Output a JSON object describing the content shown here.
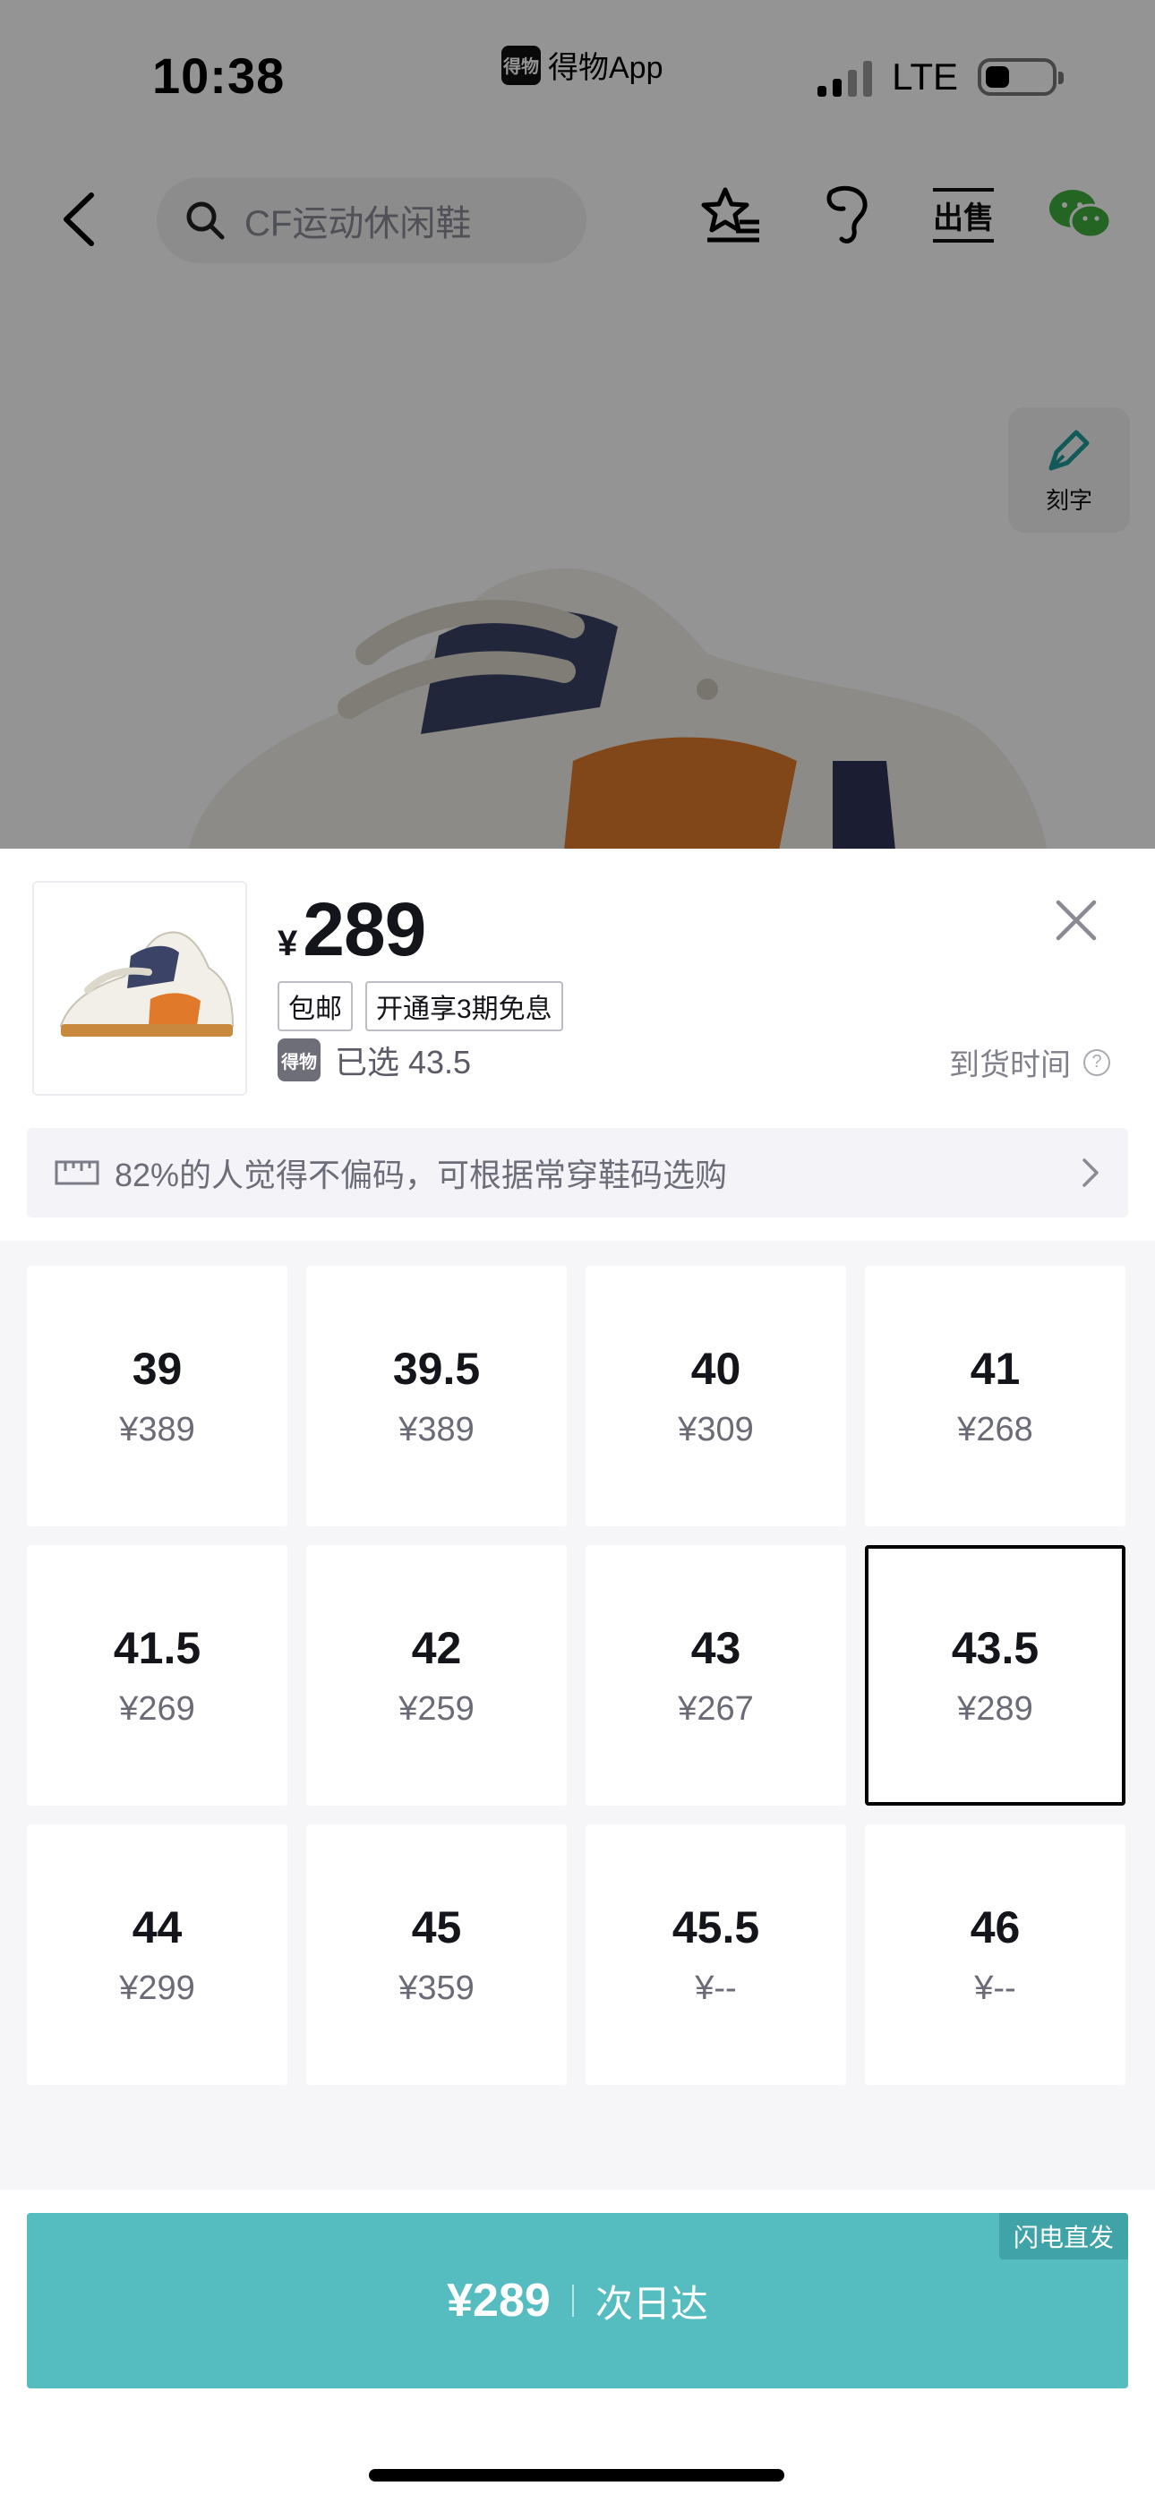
{
  "status_bar": {
    "time": "10:38",
    "app_badge": "得物",
    "app_name": "得物App",
    "network": "LTE"
  },
  "nav": {
    "search_placeholder": "CF运动休闲鞋",
    "sell_label": "出售",
    "engrave_label": "刻字"
  },
  "product": {
    "currency": "¥",
    "price": "289",
    "tags": [
      "包邮",
      "开通享3期免息"
    ],
    "brand_badge": "得物",
    "selected_text": "已选 43.5",
    "arrival_label": "到货时间",
    "help_icon": "?"
  },
  "fit_banner": {
    "text": "82%的人觉得不偏码，可根据常穿鞋码选购"
  },
  "sizes": [
    {
      "size": "39",
      "price": "¥389",
      "selected": false
    },
    {
      "size": "39.5",
      "price": "¥389",
      "selected": false
    },
    {
      "size": "40",
      "price": "¥309",
      "selected": false
    },
    {
      "size": "41",
      "price": "¥268",
      "selected": false
    },
    {
      "size": "41.5",
      "price": "¥269",
      "selected": false
    },
    {
      "size": "42",
      "price": "¥259",
      "selected": false
    },
    {
      "size": "43",
      "price": "¥267",
      "selected": false
    },
    {
      "size": "43.5",
      "price": "¥289",
      "selected": true
    },
    {
      "size": "44",
      "price": "¥299",
      "selected": false
    },
    {
      "size": "45",
      "price": "¥359",
      "selected": false
    },
    {
      "size": "45.5",
      "price": "¥--",
      "selected": false
    },
    {
      "size": "46",
      "price": "¥--",
      "selected": false
    }
  ],
  "buy": {
    "price": "¥289",
    "delivery": "次日达",
    "badge": "闪电直发"
  },
  "colors": {
    "accent": "#55bcc0",
    "accent_dark": "#3fa3a7",
    "selected_border": "#000000"
  },
  "icons": {
    "back": "chevron-left-icon",
    "search": "search-icon",
    "favorite": "star-list-icon",
    "foot": "foot-size-icon",
    "sell": "sell-icon",
    "wechat": "wechat-icon",
    "engrave": "pen-icon",
    "close": "close-icon",
    "ruler": "ruler-icon",
    "arrow": "chevron-right-icon"
  }
}
